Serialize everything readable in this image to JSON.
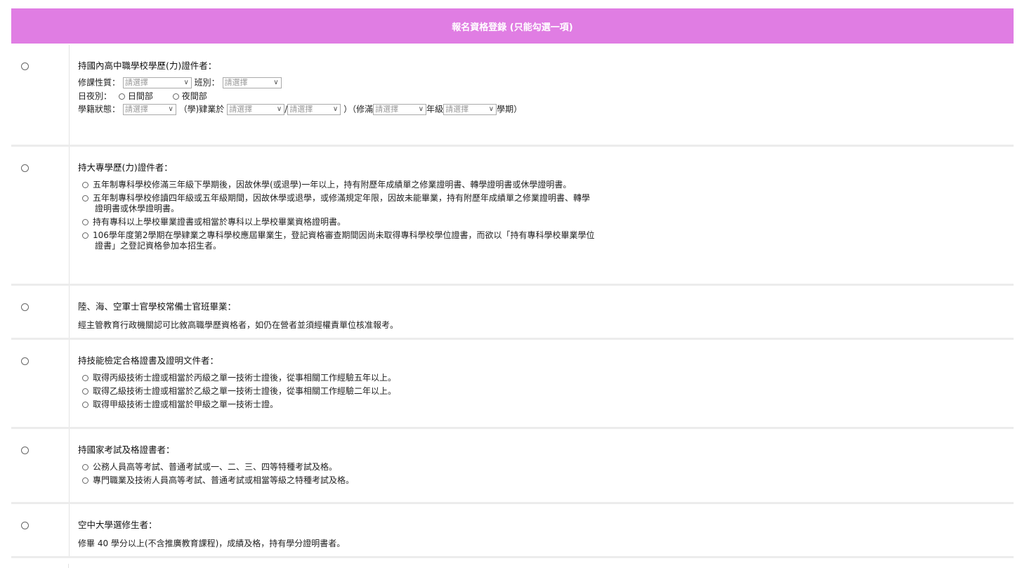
{
  "header": {
    "title": "報名資格登錄 (只能勾選一項)"
  },
  "select_placeholder": "請選擇",
  "s1": {
    "title": "持國內高中職學校學歷(力)證件者：",
    "course_label": "修課性質：",
    "class_label": "班別：",
    "daynight_label": "日夜別：",
    "day_option": "日間部",
    "night_option": "夜間部",
    "status_label": "學籍狀態：",
    "status_paren_open": "（學)肄業於",
    "slash": "/",
    "status_paren_close": "）（修滿",
    "grade_text": "年級",
    "semester_text": "學期）"
  },
  "s2": {
    "title": "持大專學歷(力)證件者：",
    "options": [
      "五年制專科學校修滿三年級下學期後，因故休學(或退學)一年以上，持有附歷年成績單之修業證明書、轉學證明書或休學證明書。",
      "五年制專科學校修讀四年級或五年級期間，因故休學或退學，或修滿規定年限，因故未能畢業，持有附歷年成績單之修業證明書、轉學",
      "證明書或休學證明書。",
      "持有專科以上學校畢業證書或相當於專科以上學校畢業資格證明書。",
      "106學年度第2學期在學肄業之專科學校應屆畢業生，登記資格審查期間因尚未取得專科學校學位證書，而欲以「持有專科學校畢業學位",
      "證書」之登記資格參加本招生者。"
    ]
  },
  "s3": {
    "title": "陸、海、空軍士官學校常備士官班畢業：",
    "desc": "經主管教育行政機關認可比敘高職學歷資格者，如仍在營者並須經權責單位核准報考。"
  },
  "s4": {
    "title": "持技能檢定合格證書及證明文件者：",
    "options": [
      "取得丙級技術士證或相當於丙級之單一技術士證後，從事相關工作經驗五年以上。",
      "取得乙級技術士證或相當於乙級之單一技術士證後，從事相關工作經驗二年以上。",
      "取得甲級技術士證或相當於甲級之單一技術士證。"
    ]
  },
  "s5": {
    "title": "持國家考試及格證書者：",
    "options": [
      "公務人員高等考試、普通考試或一、二、三、四等特種考試及格。",
      "專門職業及技術人員高等考試、普通考試或相當等級之特種考試及格。"
    ]
  },
  "s6": {
    "title": "空中大學選修生者：",
    "desc": "修畢 40 學分以上(不含推廣教育課程)，成績及格，持有學分證明書者。"
  }
}
